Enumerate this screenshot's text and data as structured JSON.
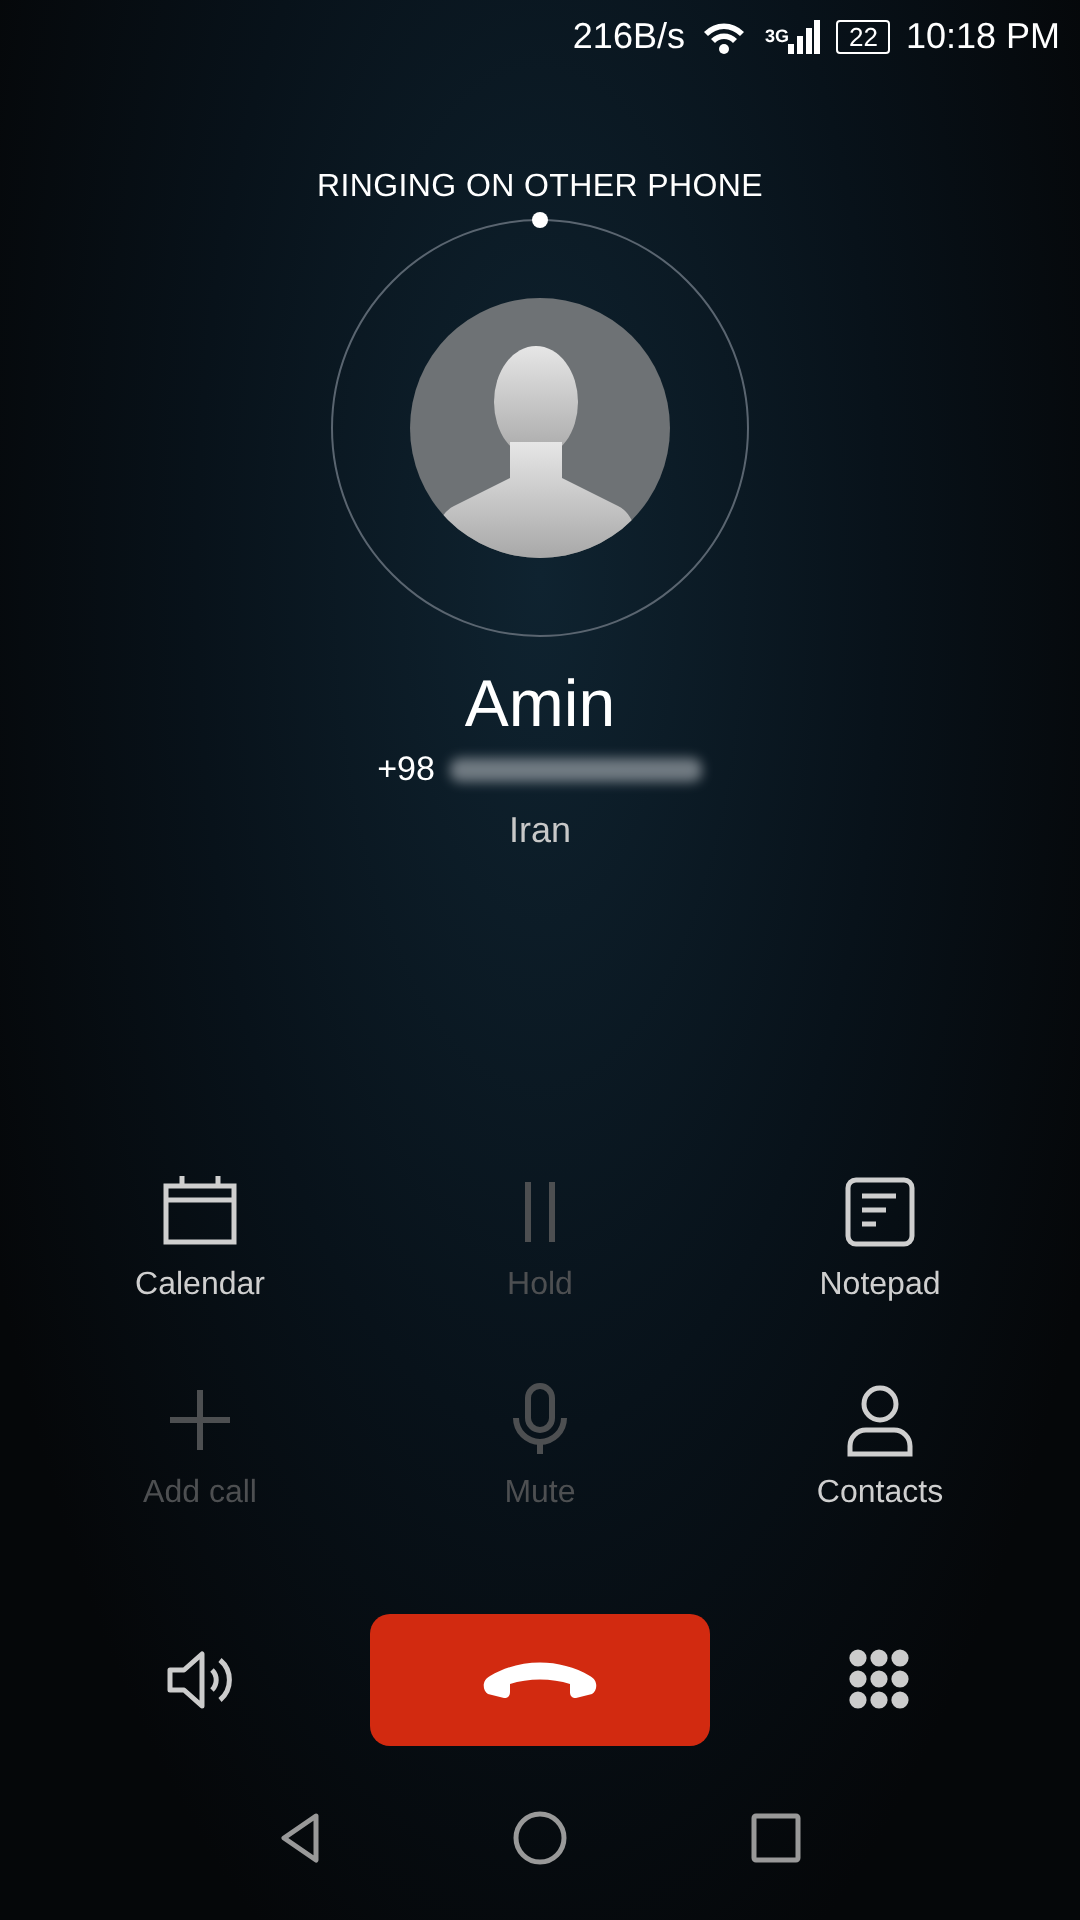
{
  "status_bar": {
    "speed": "216B/s",
    "network": "3G",
    "battery": "22",
    "time": "10:18 PM"
  },
  "call_status": "RINGING ON OTHER PHONE",
  "caller": {
    "name": "Amin",
    "number_prefix": "+98",
    "location": "Iran"
  },
  "actions": [
    {
      "kind": "calendar",
      "label": "Calendar",
      "disabled": false
    },
    {
      "kind": "hold",
      "label": "Hold",
      "disabled": true
    },
    {
      "kind": "notepad",
      "label": "Notepad",
      "disabled": false
    },
    {
      "kind": "add",
      "label": "Add call",
      "disabled": true
    },
    {
      "kind": "mute",
      "label": "Mute",
      "disabled": true
    },
    {
      "kind": "contacts",
      "label": "Contacts",
      "disabled": false
    }
  ]
}
